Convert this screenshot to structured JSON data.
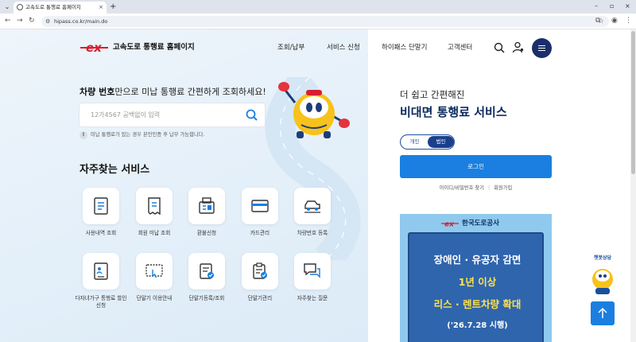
{
  "browser": {
    "tab_title": "고속도로 통행료 홈페이지",
    "tab_close": "×",
    "new_tab": "+",
    "url": "hipass.co.kr/main.do",
    "window_controls": {
      "minimize": "–",
      "maximize": "▫",
      "close": "×"
    }
  },
  "header": {
    "logo_text": "고속도로 통행료 홈페이지",
    "nav": [
      "조회/납부",
      "서비스 신청",
      "하이패스 단말기",
      "고객센터"
    ]
  },
  "lookup": {
    "title_bold": "차량 번호",
    "title_rest": "만으로 미납 통행료 간편하게 조회하세요!",
    "placeholder": "12가4567 공백없이 입력",
    "notice_icon": "!",
    "notice": "미납 통행료가 있는 경우 본인인증 후 납부 가능합니다."
  },
  "services": {
    "title": "자주찾는 서비스",
    "items": [
      {
        "label": "사용내역 조회",
        "icon": "receipt-list-icon"
      },
      {
        "label": "회원 미납 조회",
        "icon": "bill-icon"
      },
      {
        "label": "환불신청",
        "icon": "refund-machine-icon"
      },
      {
        "label": "카드관리",
        "icon": "card-icon"
      },
      {
        "label": "차량번호 등록",
        "icon": "car-icon"
      },
      {
        "label": "다자녀가구 통행료 할인 신청",
        "icon": "family-doc-icon"
      },
      {
        "label": "단말기 이용안내",
        "icon": "terminal-guide-icon"
      },
      {
        "label": "단말기등록/조회",
        "icon": "terminal-register-icon"
      },
      {
        "label": "단말기관리",
        "icon": "terminal-manage-icon"
      },
      {
        "label": "자주찾는 질문",
        "icon": "faq-chat-icon"
      }
    ]
  },
  "login_panel": {
    "subtitle": "더 쉽고 간편해진",
    "title": "비대면 통행료 서비스",
    "toggle": [
      "개인",
      "법인"
    ],
    "login_label": "로그인",
    "links": [
      "아이디/비밀번호 찾기",
      "회원가입"
    ]
  },
  "banner": {
    "org": "한국도로공사",
    "lines": [
      "장애인 · 유공자 감면",
      "1년 이상",
      "리스 · 렌트차량 확대",
      "('26.7.28 시행)"
    ]
  },
  "floating": {
    "chatbot_label": "챗봇상담"
  },
  "colors": {
    "brand_navy": "#0c2a5e",
    "primary_blue": "#1a7fe0",
    "brand_red": "#d6202c",
    "highlight_yellow": "#ffe14d"
  }
}
